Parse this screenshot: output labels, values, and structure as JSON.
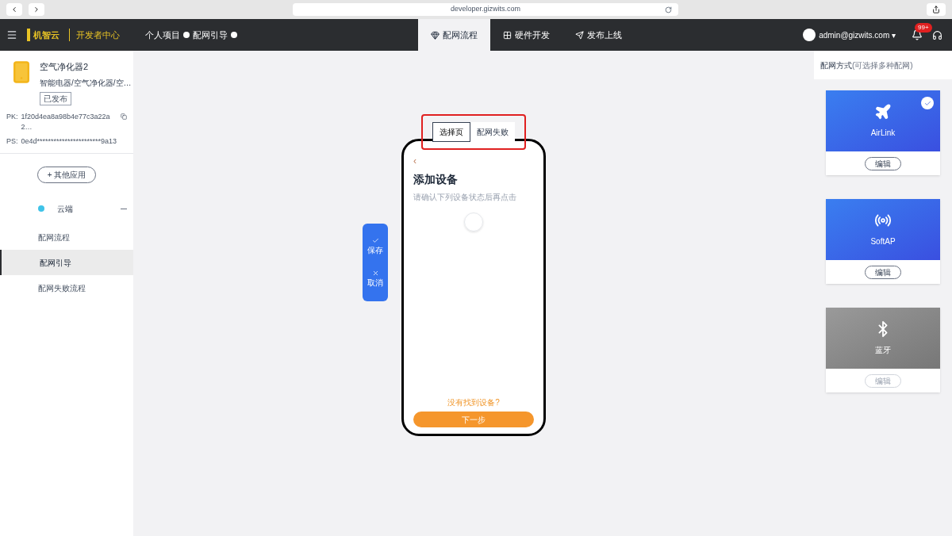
{
  "browser": {
    "address": "developer.gizwits.com"
  },
  "topbar": {
    "logo": "机智云",
    "center_label": "开发者中心",
    "breadcrumb": [
      {
        "label": "个人项目"
      },
      {
        "label": "配网引导"
      }
    ],
    "tabs": [
      {
        "label": "配网流程",
        "selected": true
      },
      {
        "label": "硬件开发",
        "selected": false
      },
      {
        "label": "发布上线",
        "selected": false
      }
    ],
    "user": "admin@gizwits.com ▾",
    "badge": "99+"
  },
  "product": {
    "name": "空气净化器2",
    "category": "智能电器/空气净化器/空…",
    "tag": "已发布",
    "keys": [
      {
        "label": "PK:",
        "value": "1f20d4ea8a98b4e77c3a22a2…"
      },
      {
        "label": "PS:",
        "value": "0e4d***********************9a13"
      }
    ]
  },
  "sidebar": {
    "add_button": "+ 其他应用",
    "group": {
      "label": "云端",
      "expanded": true
    },
    "items": [
      {
        "label": "配网流程",
        "selected": false
      },
      {
        "label": "配网引导",
        "selected": true
      },
      {
        "label": "配网失败流程",
        "selected": false
      }
    ]
  },
  "preview": {
    "tabs": [
      {
        "label": "选择页",
        "selected": true
      },
      {
        "label": "配网失败",
        "selected": false
      }
    ],
    "back": "‹",
    "title": "添加设备",
    "subtitle": "请确认下列设备状态后再点击",
    "link": "没有找到设备?",
    "primary_button": "下一步"
  },
  "float_actions": [
    {
      "label": "保存"
    },
    {
      "label": "取消"
    }
  ],
  "methods": {
    "title": "配网方式",
    "hint": "(可选择多种配网)",
    "items": [
      {
        "label": "AirLink",
        "enabled": true,
        "selected": true,
        "button": "编辑"
      },
      {
        "label": "SoftAP",
        "enabled": true,
        "selected": false,
        "button": "编辑"
      },
      {
        "label": "蓝牙",
        "enabled": false,
        "selected": false,
        "button": "编辑"
      }
    ]
  }
}
